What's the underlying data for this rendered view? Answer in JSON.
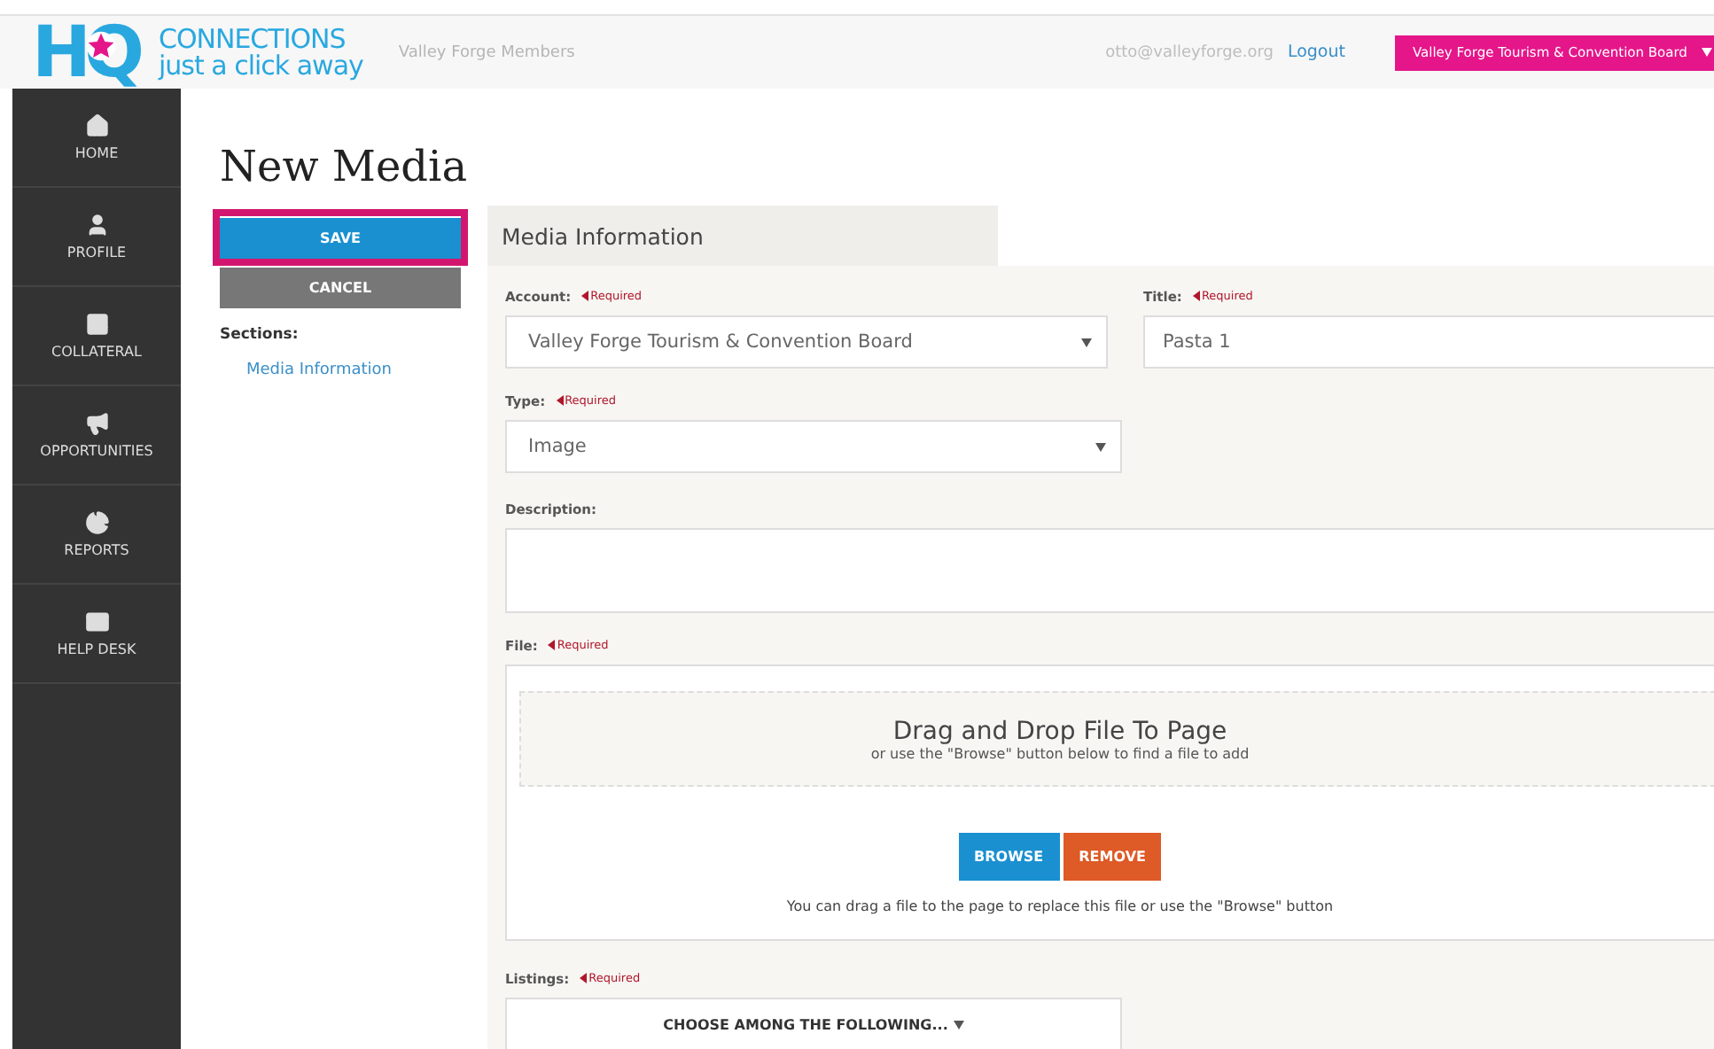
{
  "header": {
    "logo": {
      "letters": "HQ",
      "line_1": "CONNECTIONS",
      "line_2": "just a click away"
    },
    "site_name": "Valley Forge Members",
    "user_email": "otto@valleyforge.org",
    "logout": "Logout",
    "account_menu": "Valley Forge Tourism & Convention Board"
  },
  "sidebar": {
    "items": [
      {
        "kind": "home",
        "label": "HOME"
      },
      {
        "kind": "profile",
        "label": "PROFILE"
      },
      {
        "kind": "collateral",
        "label": "COLLATERAL"
      },
      {
        "kind": "opportunities",
        "label": "OPPORTUNITIES"
      },
      {
        "kind": "reports",
        "label": "REPORTS"
      },
      {
        "kind": "helpdesk",
        "label": "HELP DESK"
      }
    ]
  },
  "page": {
    "title": "New Media",
    "save": {
      "label": "SAVE",
      "highlighted": true
    },
    "cancel": "CANCEL",
    "sections_label": "Sections:",
    "sections": [
      "Media Information"
    ]
  },
  "form": {
    "tab": "Media Information",
    "account": {
      "label": "Account:",
      "required_note": "Required",
      "value": "Valley Forge Tourism & Convention Board"
    },
    "title": {
      "label": "Title:",
      "required_note": "Required",
      "value": "Pasta 1"
    },
    "type": {
      "label": "Type:",
      "required_note": "Required",
      "value": "Image"
    },
    "description": {
      "label": "Description:"
    },
    "file": {
      "label": "File:",
      "required_note": "Required",
      "drop_title": "Drag and Drop File To Page",
      "drop_hint": "or use the \"Browse\" button below to find a file to add",
      "browse": "BROWSE",
      "remove": "REMOVE",
      "note": "You can drag a file to the page to replace this file or use the \"Browse\" button"
    },
    "listings": {
      "label": "Listings:",
      "required_note": "Required",
      "button": "CHOOSE AMONG THE FOLLOWING..."
    }
  }
}
